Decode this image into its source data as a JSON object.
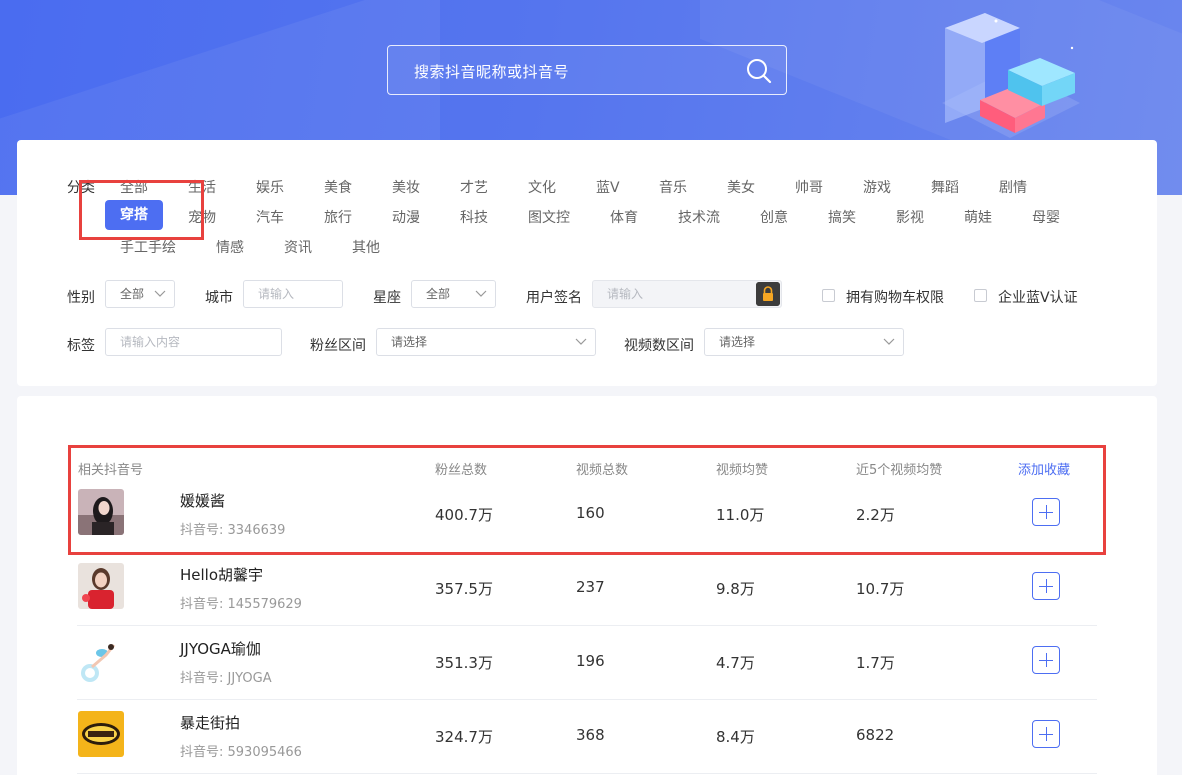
{
  "search": {
    "placeholder": "搜索抖音昵称或抖音号"
  },
  "categories": {
    "label": "分类",
    "rows": [
      [
        "全部",
        "生活",
        "娱乐",
        "美食",
        "美妆",
        "才艺",
        "文化",
        "蓝V",
        "音乐",
        "美女",
        "帅哥",
        "游戏",
        "舞蹈",
        "剧情"
      ],
      [
        "穿搭",
        "宠物",
        "汽车",
        "旅行",
        "动漫",
        "科技",
        "图文控",
        "体育",
        "技术流",
        "创意",
        "搞笑",
        "影视",
        "萌娃",
        "母婴"
      ],
      [
        "手工手绘",
        "情感",
        "资讯",
        "其他"
      ]
    ],
    "active": "穿搭"
  },
  "filters": {
    "gender_label": "性别",
    "gender_value": "全部",
    "city_label": "城市",
    "city_placeholder": "请输入",
    "zodiac_label": "星座",
    "zodiac_value": "全部",
    "signature_label": "用户签名",
    "signature_placeholder": "请输入",
    "cart_label": "拥有购物车权限",
    "bluev_label": "企业蓝V认证",
    "tag_label": "标签",
    "tag_placeholder": "请输入内容",
    "fans_label": "粉丝区间",
    "fans_value": "请选择",
    "videos_label": "视频数区间",
    "videos_value": "请选择"
  },
  "table": {
    "headers": {
      "account": "相关抖音号",
      "fans": "粉丝总数",
      "videos": "视频总数",
      "avg_likes": "视频均赞",
      "recent5": "近5个视频均赞",
      "add": "添加收藏"
    },
    "rows": [
      {
        "name": "媛媛酱",
        "id": "抖音号: 3346639",
        "fans": "400.7万",
        "videos": "160",
        "avg": "11.0万",
        "recent": "2.2万"
      },
      {
        "name": "Hello胡馨宇",
        "id": "抖音号: 145579629",
        "fans": "357.5万",
        "videos": "237",
        "avg": "9.8万",
        "recent": "10.7万"
      },
      {
        "name": "JJYOGA瑜伽",
        "id": "抖音号: JJYOGA",
        "fans": "351.3万",
        "videos": "196",
        "avg": "4.7万",
        "recent": "1.7万"
      },
      {
        "name": "暴走街拍",
        "id": "抖音号: 593095466",
        "fans": "324.7万",
        "videos": "368",
        "avg": "8.4万",
        "recent": "6822"
      }
    ]
  },
  "colors": {
    "accent": "#4d6ef2",
    "highlight": "#e8413e",
    "hero": "#4a6cf0"
  }
}
